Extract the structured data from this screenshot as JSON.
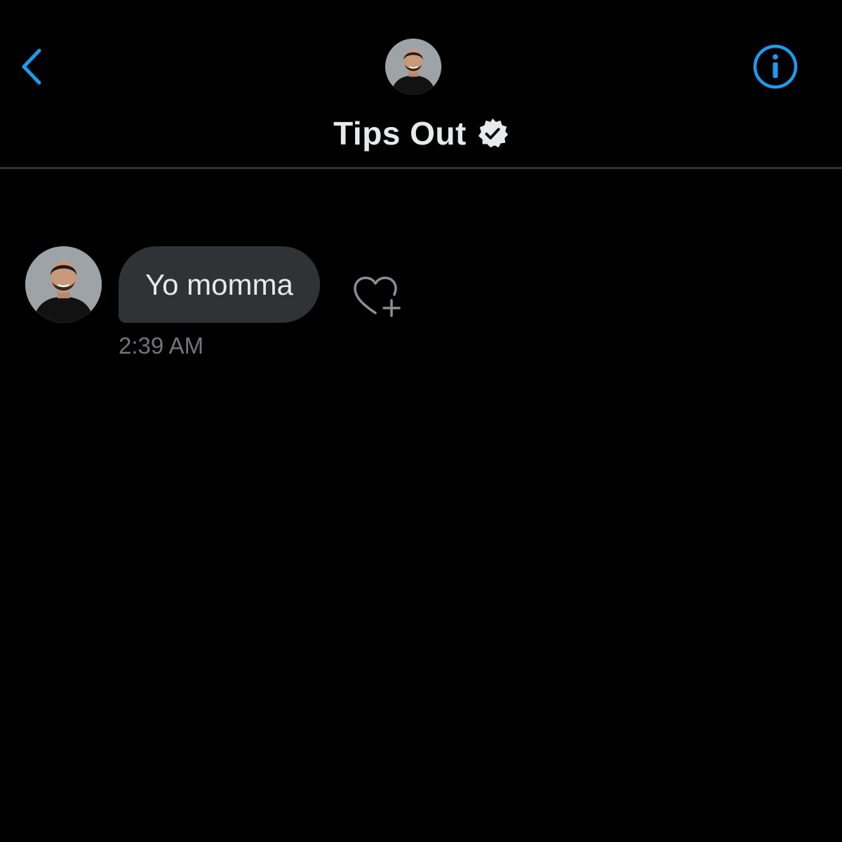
{
  "header": {
    "back_icon": "chevron-left-icon",
    "info_icon": "info-icon",
    "title": "Tips Out",
    "verified_icon": "verified-badge-icon",
    "accent_color": "#1d9bf0"
  },
  "conversation": {
    "messages": [
      {
        "text": "Yo momma",
        "time": "2:39 AM",
        "reaction_icon": "heart-add-icon"
      }
    ]
  },
  "colors": {
    "background": "#000000",
    "bubble": "#2f3336",
    "text": "#e7e9ea",
    "muted_text": "#71767b",
    "divider": "#2f3336"
  }
}
